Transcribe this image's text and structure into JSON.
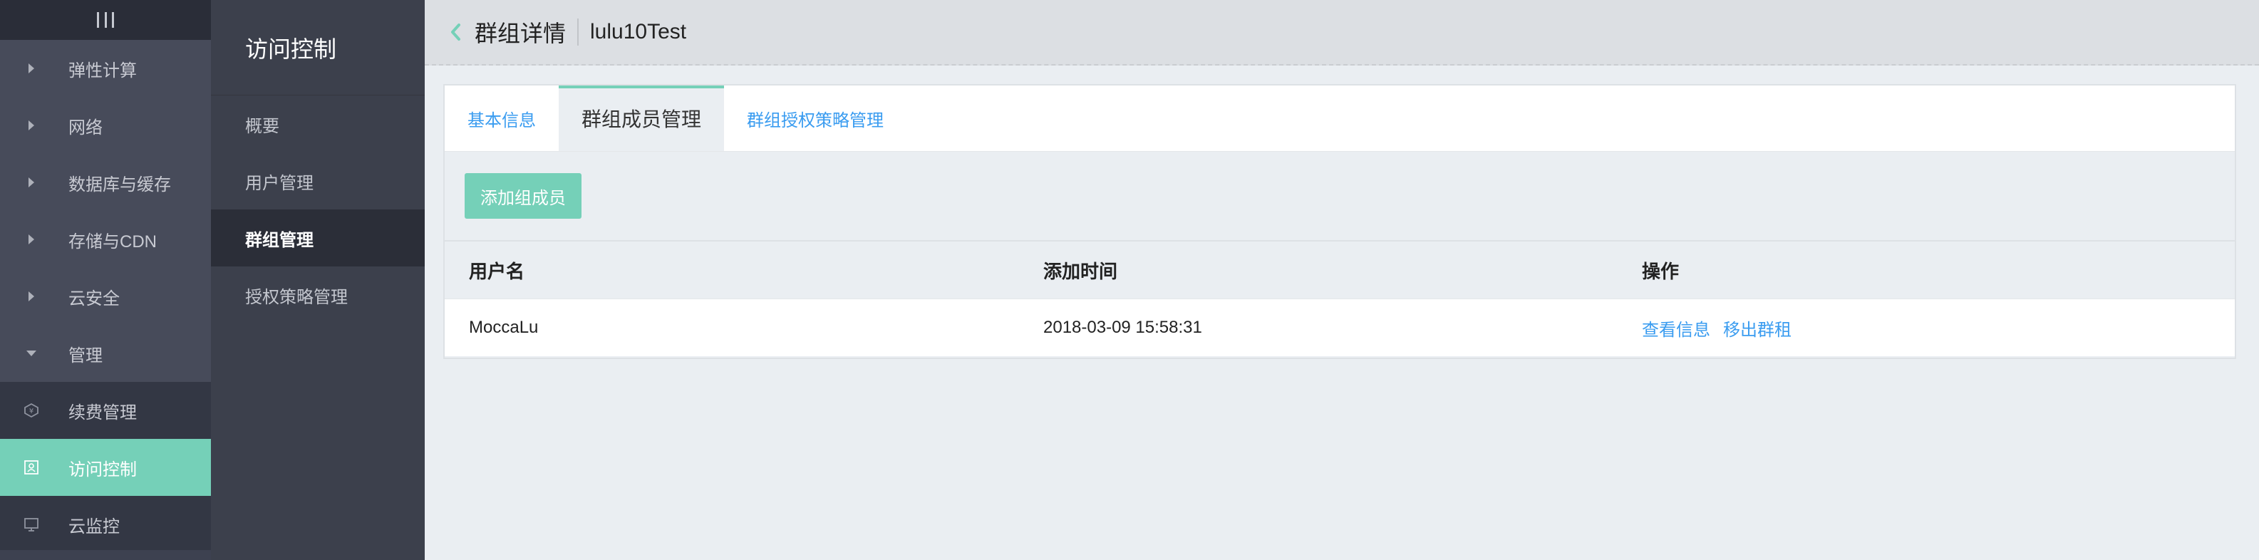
{
  "nav_primary": {
    "menu_icon": "hamburger-icon",
    "groups": [
      {
        "label": "弹性计算"
      },
      {
        "label": "网络"
      },
      {
        "label": "数据库与缓存"
      },
      {
        "label": "存储与CDN"
      },
      {
        "label": "云安全"
      },
      {
        "label": "管理"
      }
    ],
    "items": [
      {
        "label": "续费管理",
        "icon": "renewal-icon"
      },
      {
        "label": "访问控制",
        "icon": "access-control-icon"
      },
      {
        "label": "云监控",
        "icon": "monitor-icon"
      }
    ]
  },
  "nav_secondary": {
    "title": "访问控制",
    "items": [
      {
        "label": "概要"
      },
      {
        "label": "用户管理"
      },
      {
        "label": "群组管理"
      },
      {
        "label": "授权策略管理"
      }
    ]
  },
  "header": {
    "title": "群组详情",
    "group_name": "lulu10Test"
  },
  "tabs": [
    {
      "label": "基本信息"
    },
    {
      "label": "群组成员管理"
    },
    {
      "label": "群组授权策略管理"
    }
  ],
  "toolbar": {
    "add_member_label": "添加组成员"
  },
  "table": {
    "columns": [
      "用户名",
      "添加时间",
      "操作"
    ],
    "rows": [
      {
        "username": "MoccaLu",
        "added": "2018-03-09 15:58:31",
        "actions": [
          "查看信息",
          "移出群租"
        ]
      }
    ]
  },
  "colors": {
    "accent": "#75d0b8",
    "link": "#3a9cf0",
    "nav_bg": "#333744",
    "nav2_bg": "#3c404c"
  }
}
